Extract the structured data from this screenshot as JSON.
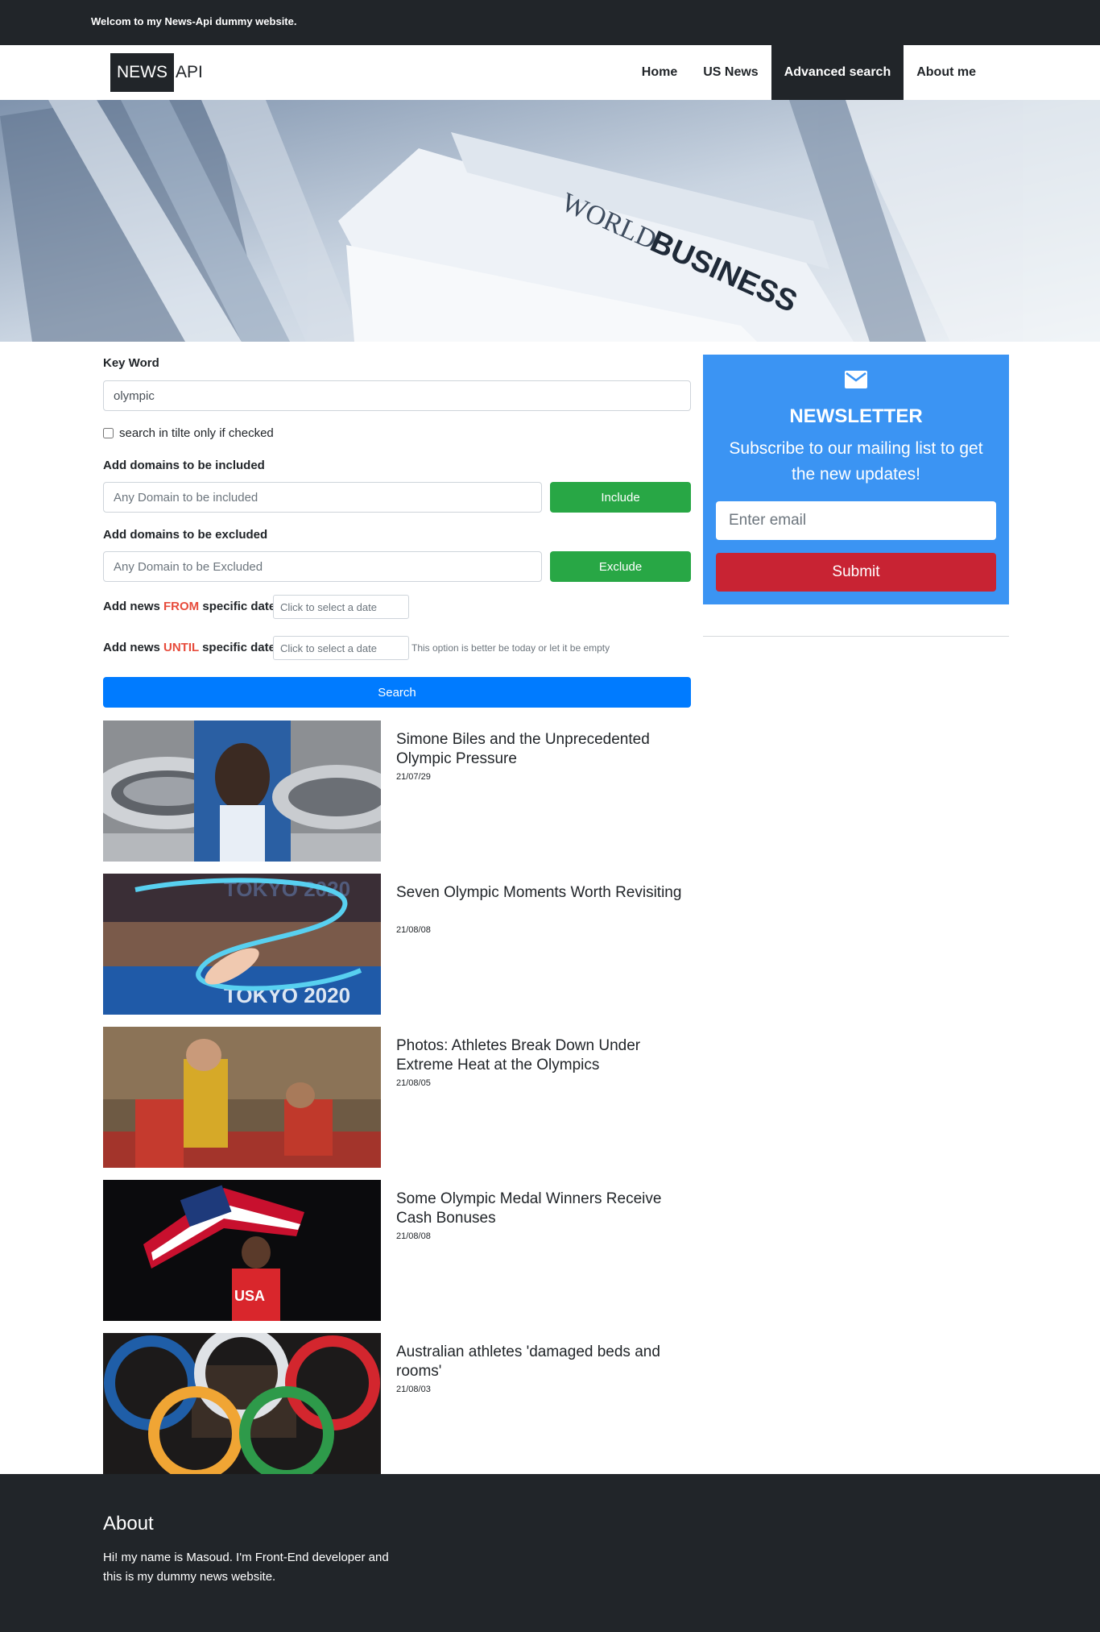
{
  "topbar": {
    "text": "Welcom to my News-Api dummy website."
  },
  "logo": {
    "part1": "NEWS",
    "part2": "API"
  },
  "nav": {
    "items": [
      {
        "label": "Home",
        "active": false
      },
      {
        "label": "US News",
        "active": false
      },
      {
        "label": "Advanced search",
        "active": true
      },
      {
        "label": "About me",
        "active": false
      }
    ]
  },
  "hero": {
    "text_world": "WORLD",
    "text_business": "BUSINESS"
  },
  "search_form": {
    "keyword_label": "Key Word",
    "keyword_value": "olympic",
    "title_only_label": "search in tilte only if checked",
    "title_only_checked": false,
    "include_label": "Add domains to be included",
    "include_placeholder": "Any Domain to be included",
    "include_button": "Include",
    "exclude_label": "Add domains to be excluded",
    "exclude_placeholder": "Any Domain to be Excluded",
    "exclude_button": "Exclude",
    "from_prefix": "Add news",
    "from_word": "FROM",
    "from_suffix": "specific date",
    "from_placeholder": "Click to select a date",
    "until_prefix": "Add news",
    "until_word": "UNTIL",
    "until_suffix": "specific date",
    "until_placeholder": "Click to select a date",
    "until_hint": "This option is better be today or let it be empty",
    "search_button": "Search"
  },
  "articles": [
    {
      "title": "Simone Biles and the Unprecedented Olympic Pressure",
      "date": "21/07/29",
      "thumb_icon": "stadium-portrait-image"
    },
    {
      "title": "Seven Olympic Moments Worth Revisiting",
      "date": "21/08/08",
      "thumb_icon": "gymnast-ribbon-image"
    },
    {
      "title": "Photos: Athletes Break Down Under Extreme Heat at the Olympics",
      "date": "21/08/05",
      "thumb_icon": "athletes-heat-image"
    },
    {
      "title": "Some Olympic Medal Winners Receive Cash Bonuses",
      "date": "21/08/08",
      "thumb_icon": "usa-flag-athlete-image"
    },
    {
      "title": "Australian athletes 'damaged beds and rooms'",
      "date": "21/08/03",
      "thumb_icon": "olympic-rings-image"
    }
  ],
  "thumb_texts": {
    "tokyo": "TOKYO 2020",
    "usa": "USA"
  },
  "newsletter": {
    "icon": "envelope-icon",
    "title": "NEWSLETTER",
    "text": "Subscribe to our mailing list to get the new updates!",
    "email_placeholder": "Enter email",
    "submit_label": "Submit"
  },
  "footer": {
    "title": "About",
    "text": "Hi! my name is Masoud. I'm Front-End developer and this is my dummy news website."
  },
  "colors": {
    "dark": "#212529",
    "green": "#28a745",
    "blue": "#007bff",
    "newsletter_bg": "#3b94f3",
    "submit_red": "#c82333",
    "accent_red": "#e74c3c"
  }
}
